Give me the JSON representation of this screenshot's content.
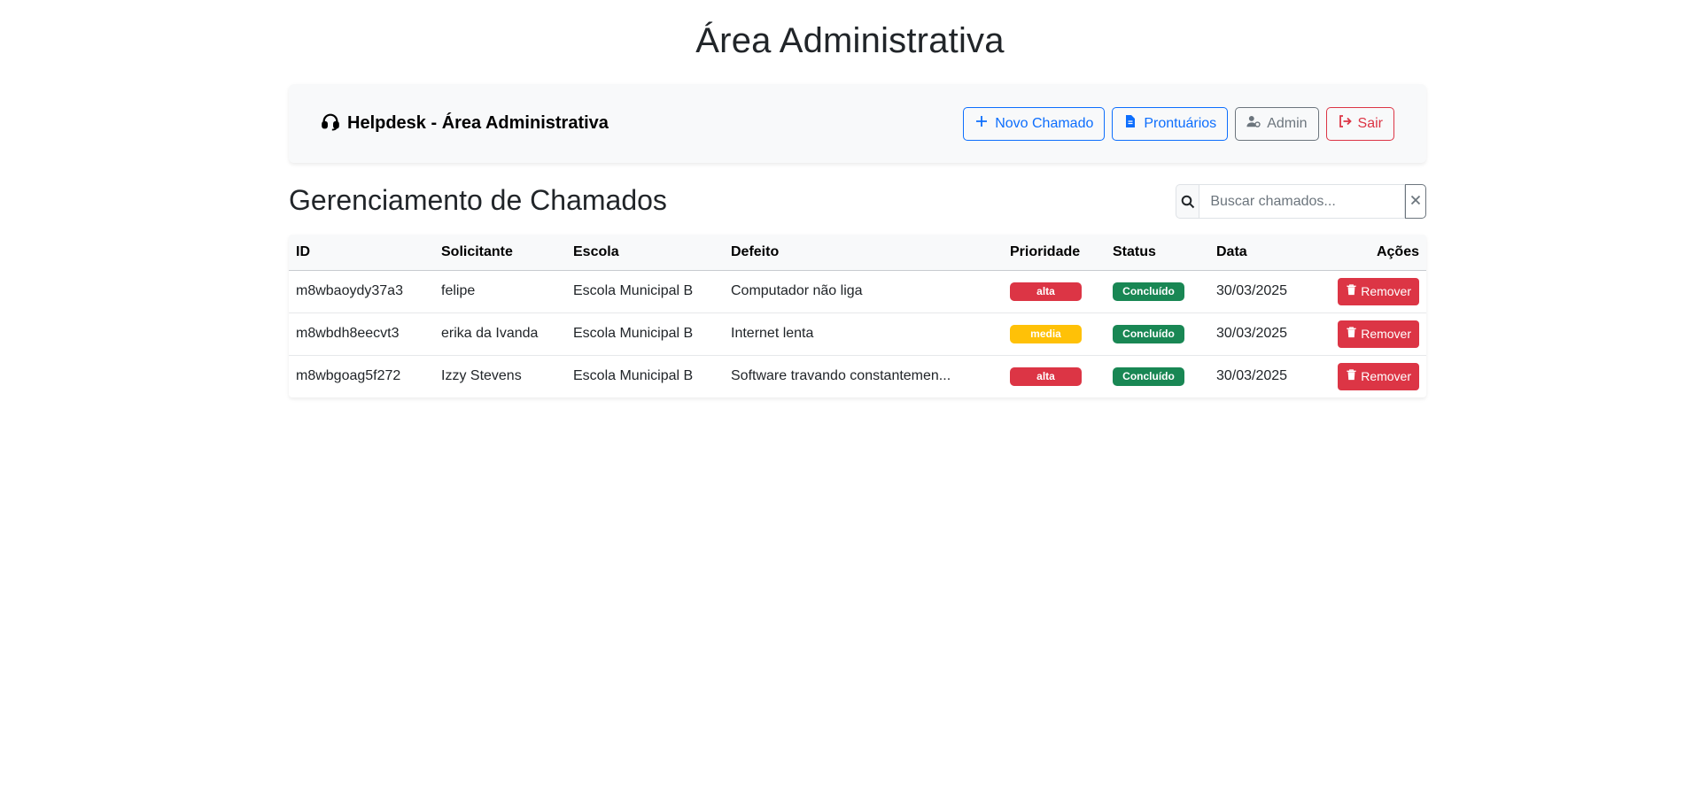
{
  "page": {
    "title": "Área Administrativa"
  },
  "navbar": {
    "brand": "Helpdesk - Área Administrativa",
    "brand_icon": "headset-icon",
    "buttons": [
      {
        "label": "Novo Chamado",
        "icon": "plus-icon",
        "variant": "primary"
      },
      {
        "label": "Prontuários",
        "icon": "file-icon",
        "variant": "primary"
      },
      {
        "label": "Admin",
        "icon": "user-gear-icon",
        "variant": "secondary"
      },
      {
        "label": "Sair",
        "icon": "sign-out-icon",
        "variant": "danger"
      }
    ]
  },
  "section": {
    "title": "Gerenciamento de Chamados"
  },
  "search": {
    "placeholder": "Buscar chamados...",
    "value": ""
  },
  "colors": {
    "primary": "#0d6efd",
    "secondary": "#6c757d",
    "danger": "#dc3545",
    "warning": "#ffc107",
    "success": "#198754"
  },
  "table": {
    "headers": [
      "ID",
      "Solicitante",
      "Escola",
      "Defeito",
      "Prioridade",
      "Status",
      "Data",
      "Ações"
    ],
    "rows": [
      {
        "id": "m8wbaoydy37a3",
        "solicitante": "felipe",
        "escola": "Escola Municipal B",
        "defeito": "Computador não liga",
        "prioridade": "alta",
        "prioridade_color": "#dc3545",
        "status": "Concluído",
        "status_color": "#198754",
        "data": "30/03/2025",
        "acao": "Remover"
      },
      {
        "id": "m8wbdh8eecvt3",
        "solicitante": "erika da Ivanda",
        "escola": "Escola Municipal B",
        "defeito": "Internet lenta",
        "prioridade": "media",
        "prioridade_color": "#ffc107",
        "status": "Concluído",
        "status_color": "#198754",
        "data": "30/03/2025",
        "acao": "Remover"
      },
      {
        "id": "m8wbgoag5f272",
        "solicitante": "Izzy Stevens",
        "escola": "Escola Municipal B",
        "defeito": "Software travando constantemen...",
        "prioridade": "alta",
        "prioridade_color": "#dc3545",
        "status": "Concluído",
        "status_color": "#198754",
        "data": "30/03/2025",
        "acao": "Remover"
      }
    ]
  }
}
